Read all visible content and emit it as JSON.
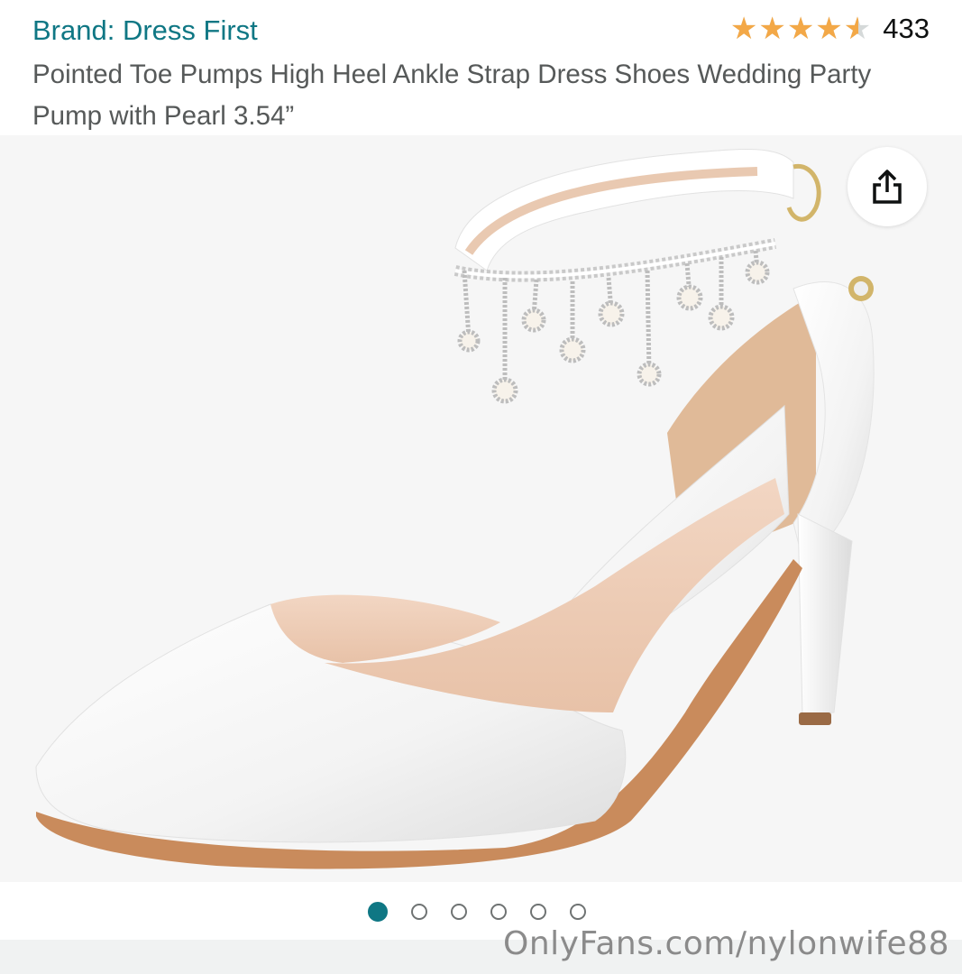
{
  "product": {
    "brand_link": "Brand: Dress First",
    "title": "Pointed Toe Pumps High Heel Ankle Strap Dress Shoes Wedding Party Pump with Pearl 3.54”",
    "rating": {
      "stars_value": 4.5,
      "stars_out_of": 5,
      "review_count": "433"
    }
  },
  "gallery": {
    "share_icon": "share-icon",
    "image_count": 6,
    "active_index": 0
  },
  "watermark": "OnlyFans.com/nylonwife88",
  "colors": {
    "brand_link": "#0f7784",
    "star": "#f3a847",
    "dot_active": "#0f7784",
    "title": "#565959"
  }
}
